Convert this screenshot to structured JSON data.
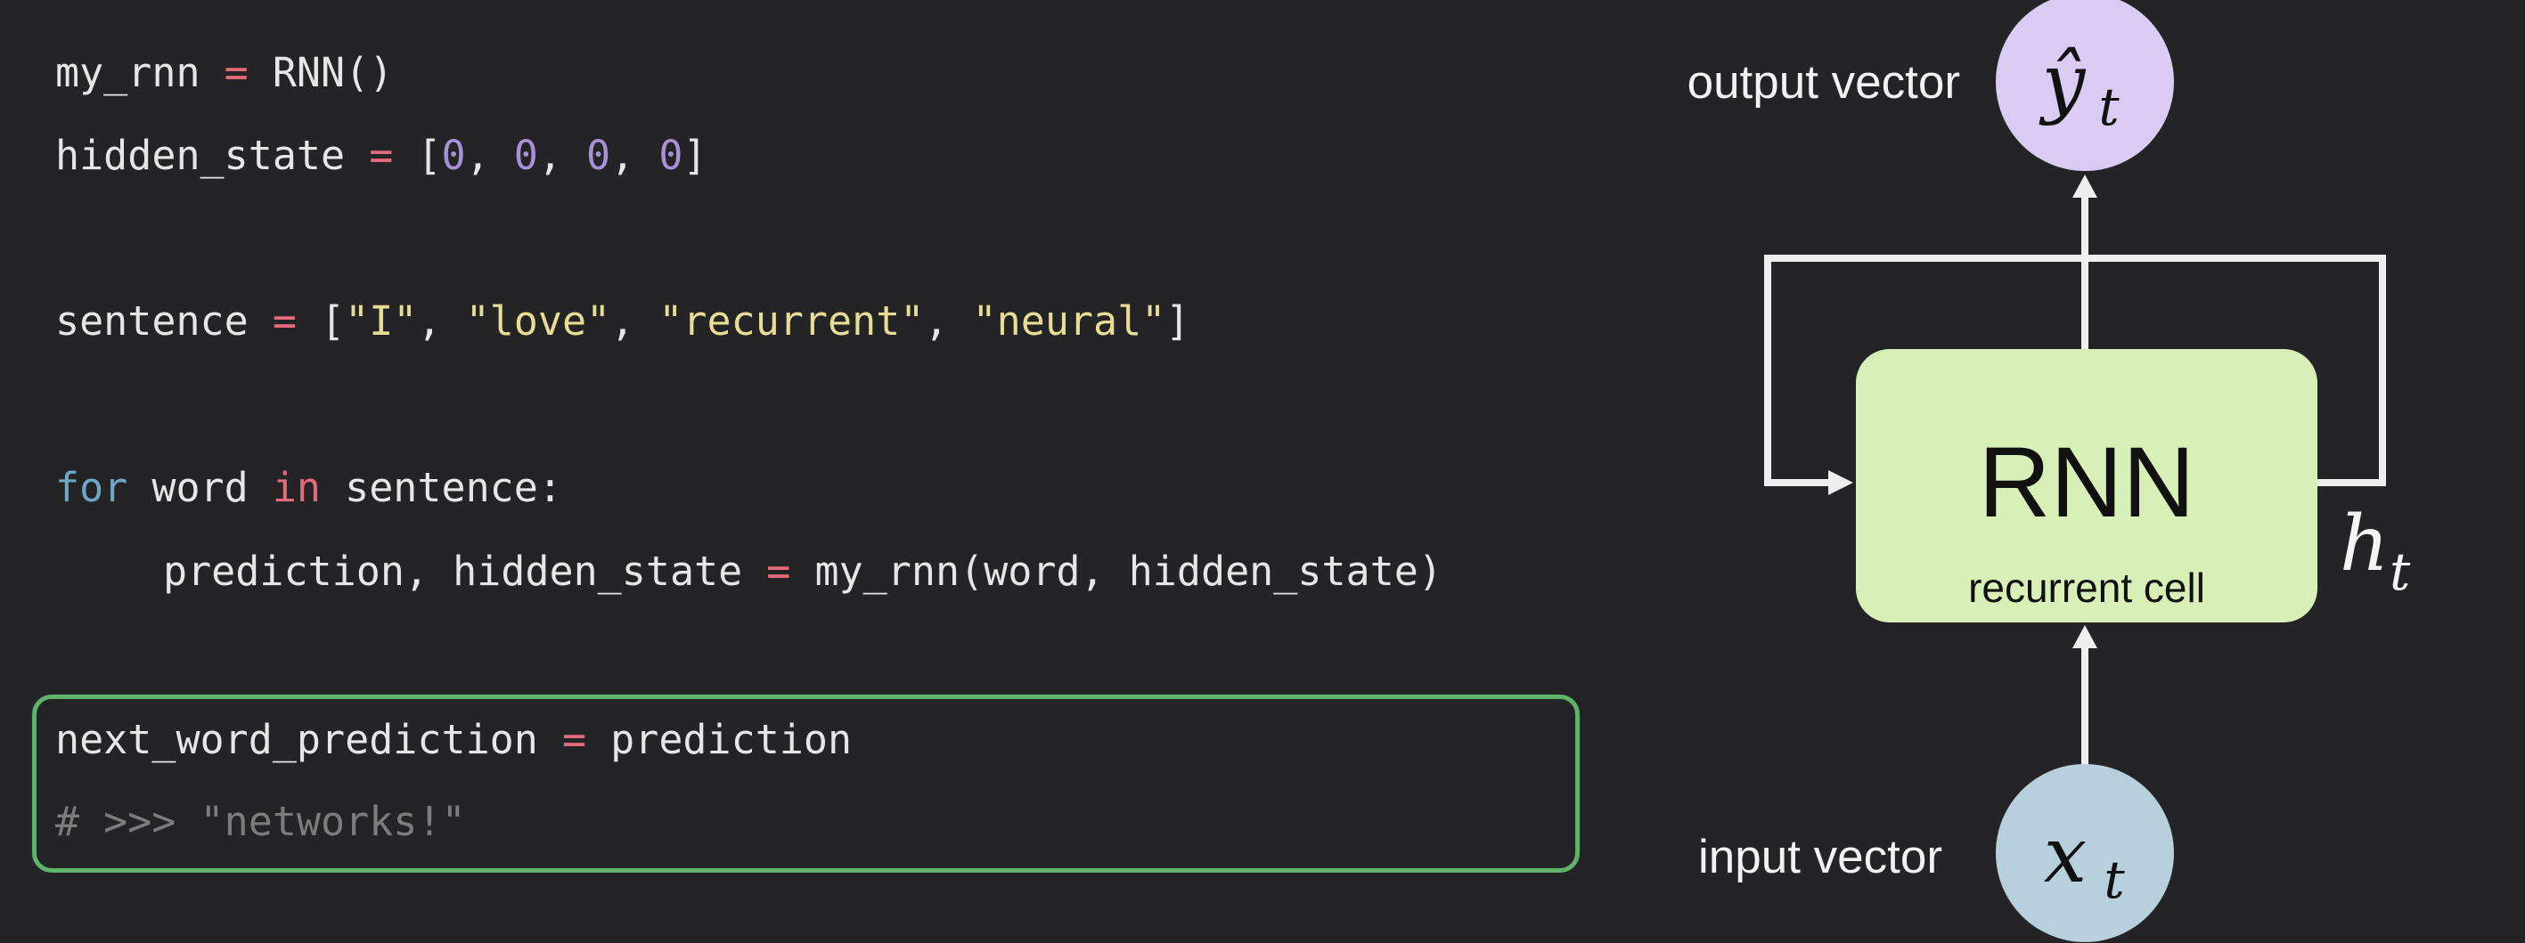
{
  "code": {
    "line1": {
      "var": "my_rnn",
      "op": " = ",
      "call": "RNN()"
    },
    "line2": {
      "var": "hidden_state",
      "op": " = ",
      "open": "[",
      "n1": "0",
      "sep1": ", ",
      "n2": "0",
      "sep2": ", ",
      "n3": "0",
      "sep3": ", ",
      "n4": "0",
      "close": "]"
    },
    "line3": {
      "var": "sentence",
      "op": " = ",
      "open": "[",
      "s1": "\"I\"",
      "sep1": ", ",
      "s2": "\"love\"",
      "sep2": ", ",
      "s3": "\"recurrent\"",
      "sep3": ", ",
      "s4": "\"neural\"",
      "close": "]"
    },
    "line4": {
      "kw_for": "for",
      "var": " word ",
      "kw_in": "in",
      "rest": " sentence:"
    },
    "line5": {
      "lhs": "prediction, hidden_state",
      "op": " = ",
      "rhs": "my_rnn(word, hidden_state)"
    },
    "line6": {
      "var": "next_word_prediction",
      "op": " = ",
      "rhs": "prediction"
    },
    "line7": {
      "comment": "# >>> \"networks!\""
    }
  },
  "diagram": {
    "output_label": "output vector",
    "input_label": "input vector",
    "output_symbol": "ŷ",
    "output_subscript": "t",
    "input_symbol": "x",
    "input_subscript": "t",
    "hidden_symbol": "h",
    "hidden_subscript": "t",
    "cell_title": "RNN",
    "cell_subtitle": "recurrent cell"
  },
  "colors": {
    "background": "#242426",
    "highlight_border": "#5fb36a",
    "cell_fill": "#d8f0b8",
    "output_node_fill": "#d9cbf1",
    "input_node_fill": "#b7d0dc",
    "keyword": "#6fa6c6",
    "operator": "#e26a7a",
    "number": "#a792d8",
    "string": "#e8dd95",
    "comment": "#7c7c7c"
  }
}
